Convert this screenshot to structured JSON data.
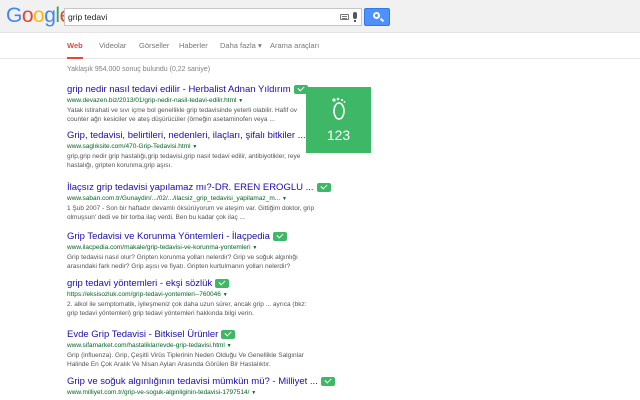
{
  "logo": {
    "letters": [
      "G",
      "o",
      "o",
      "g",
      "l",
      "e"
    ],
    "colors": [
      "#4285f4",
      "#ea4335",
      "#fbbc05",
      "#4285f4",
      "#34a853",
      "#ea4335"
    ]
  },
  "search": {
    "value": "grip tedavi"
  },
  "tabs": [
    {
      "label": "Web",
      "active": true
    },
    {
      "label": "Videolar"
    },
    {
      "label": "Görseller"
    },
    {
      "label": "Haberler"
    },
    {
      "label": "Daha fazla ▾"
    },
    {
      "label": "Arama araçları"
    }
  ],
  "stats": "Yaklaşık 954.000 sonuç bulundu (0,22 saniye)",
  "results": [
    {
      "title": "grip nedir nasıl tedavi edilir - Herbalist Adnan Yıldırım",
      "url": "www.devazen.biz/2013/01/grip-nedir-nasil-tedavi-edilir.html",
      "snippet": [
        "Yatak istirahati ve sıvı içme bol genellikle grip tedavisinde yeterli olabilir. Hafif ov",
        "counter ağrı kesiciler ve ateş düşürücüler (örneğin asetaminofen veya ..."
      ]
    },
    {
      "title": "Grip, tedavisi, belirtileri, nedenleri, ilaçları, şifalı bitkiler ...",
      "url": "www.saglıksite.com/470-Grip-Tedavisi.html",
      "snippet": [
        "grip,grip nedir grip hastalığı,grip tedavisi,grip nasıl tedavi edilir, antibiyotikler, reye",
        "hastalığı, gripten korunma,grip aşısı."
      ]
    },
    {
      "title": "İlaçsız grip tedavisi yapılamaz mı?-DR. EREN EROGLU ...",
      "url": "www.saban.com.tr/Gunaydin/.../02/.../ilacsiz_grip_tedavisi_yapilamaz_m...",
      "snippet": [
        "1 Şub 2007 - Son bir haftadır devamlı öksürüyorum ve ateşim var. Gittiğim doktor, grip",
        "olmuşsun' dedi ve bir torba ilaç verdi. Ben bu kadar çok ilaç ..."
      ]
    },
    {
      "title": "Grip Tedavisi ve Korunma Yöntemleri - İlaçpedia",
      "url": "www.ilacpedia.com/makale/grip-tedavisi-ve-korunma-yontemleri",
      "snippet": [
        "Grip tedavisi nasıl olur? Gripten korunma yolları nelerdir? Grip ve soğuk algınlığı",
        "arasındaki fark nedir? Grip aşısı ve fiyatı. Gripten kurtulmanın yolları nelerdir?"
      ]
    },
    {
      "title": "grip tedavi yöntemleri - ekşi sözlük",
      "url": "https://eksisozluk.com/grip-tedavi-yontemleri--760046",
      "snippet": [
        "2. alkol ile semptomatik, iyileşmeniz çok daha uzun sürer, ancak grip ... ayrıca (bkz:",
        "grip tedavi yöntemleri) grip tedavi yöntemleri hakkında bilgi verin."
      ]
    },
    {
      "title": "Evde Grip Tedavisi - Bitkisel Ürünler",
      "url": "www.sifamarket.com/hastaliklar/evde-grip-tedavisi.html",
      "snippet": [
        "Grip (influenza). Grip, Çeşitli Virüs Tiplerinin Neden Olduğu Ve Genellikle Salgınlar",
        "Halinde En Çok Aralık Ve Nisan Ayları Arasında Görülen Bir Hastalıktır."
      ]
    },
    {
      "title": "Grip ve soğuk algınlığının tedavisi mümkün mü? - Milliyet ...",
      "url": "www.milliyet.com.tr/grip-ve-soguk-alginliginin-tedavisi-1797514/",
      "snippet": []
    }
  ],
  "panel": {
    "number": "123",
    "icon": "footprint-icon",
    "color": "#3eb866"
  }
}
